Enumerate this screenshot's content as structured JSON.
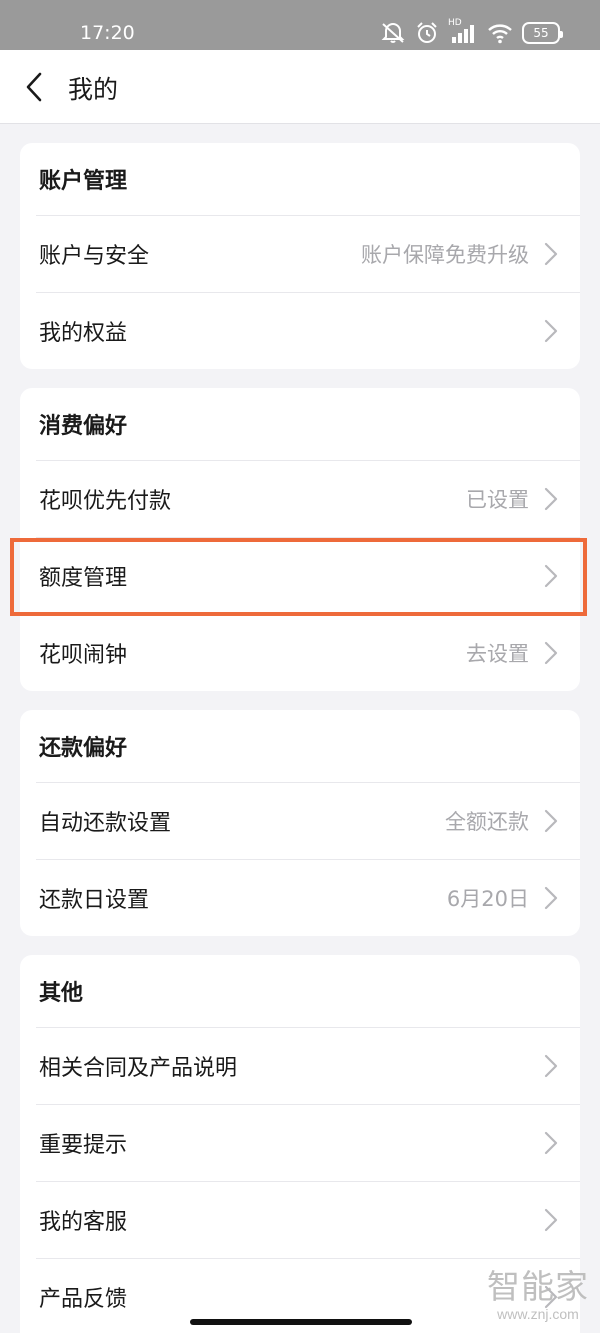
{
  "status_bar": {
    "time": "17:20",
    "battery": "55",
    "network_label": "HD",
    "icons": [
      "mute-icon",
      "alarm-icon",
      "signal-icon",
      "wifi-icon",
      "battery-icon"
    ]
  },
  "nav": {
    "title": "我的",
    "back_icon": "chevron-left-icon"
  },
  "sections": [
    {
      "title": "账户管理",
      "rows": [
        {
          "label": "账户与安全",
          "value": "账户保障免费升级"
        },
        {
          "label": "我的权益",
          "value": ""
        }
      ]
    },
    {
      "title": "消费偏好",
      "rows": [
        {
          "label": "花呗优先付款",
          "value": "已设置"
        },
        {
          "label": "额度管理",
          "value": ""
        },
        {
          "label": "花呗闹钟",
          "value": "去设置"
        }
      ]
    },
    {
      "title": "还款偏好",
      "rows": [
        {
          "label": "自动还款设置",
          "value": "全额还款"
        },
        {
          "label": "还款日设置",
          "value": "6月20日"
        }
      ]
    },
    {
      "title": "其他",
      "rows": [
        {
          "label": "相关合同及产品说明",
          "value": ""
        },
        {
          "label": "重要提示",
          "value": ""
        },
        {
          "label": "我的客服",
          "value": ""
        },
        {
          "label": "产品反馈",
          "value": ""
        }
      ]
    }
  ],
  "watermark": {
    "text": "智能家",
    "url": "www.znj.com"
  },
  "colors": {
    "highlight": "#ee6a3a",
    "background": "#f3f3f6",
    "secondary_text": "#a8a8ac"
  }
}
